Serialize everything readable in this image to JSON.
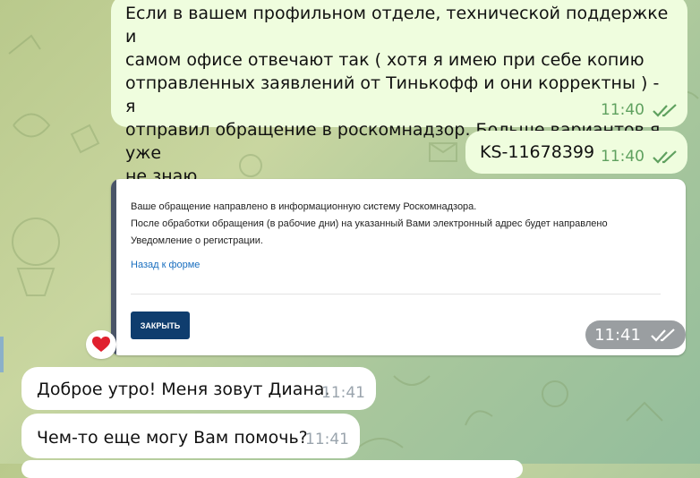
{
  "colors": {
    "outgoing_bubble": "#effdde",
    "incoming_bubble": "#ffffff",
    "outgoing_time": "#5fa15f",
    "close_button": "#0f3d6e",
    "link": "#1a6fbf"
  },
  "messages": {
    "first": {
      "lines": [
        "Если в вашем профильном отделе, технической поддержке и",
        "самом офисе отвечают так ( хотя я имею при себе копию",
        "отправленных заявлений от Тинькофф и они корректны ) - я",
        "отправил обращение в роскомнадзор. Больше вариантов я уже",
        "не знаю"
      ],
      "time": "11:40"
    },
    "ticket": {
      "text": "KS-11678399",
      "time": "11:40"
    },
    "screenshot": {
      "notice_lines": [
        "Ваше обращение направлено в информационную систему Роскомнадзора.",
        "После обработки обращения (в рабочие дни) на указанный Вами электронный адрес будет направлено",
        "Уведомление о регистрации."
      ],
      "back_link": "Назад к форме",
      "close_button": "ЗАКРЫТЬ",
      "time": "11:41"
    },
    "reaction": {
      "emoji": "❤️"
    },
    "greeting": {
      "text": "Доброе утро! Меня зовут Диана.",
      "time": "11:41"
    },
    "help": {
      "text": "Чем-то еще могу Вам помочь?",
      "time": "11:41"
    }
  },
  "icons": {
    "read_checks": "double-check-icon",
    "heart": "heart-icon"
  }
}
